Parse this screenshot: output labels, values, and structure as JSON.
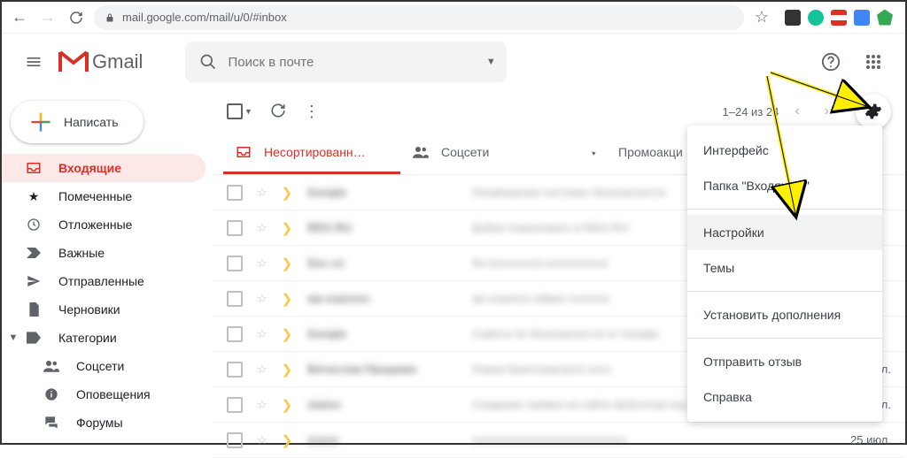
{
  "browser": {
    "url": "mail.google.com/mail/u/0/#inbox"
  },
  "header": {
    "logo_text": "Gmail",
    "search_placeholder": "Поиск в почте"
  },
  "sidebar": {
    "compose": "Написать",
    "items": [
      {
        "label": "Входящие"
      },
      {
        "label": "Помеченные"
      },
      {
        "label": "Отложенные"
      },
      {
        "label": "Важные"
      },
      {
        "label": "Отправленные"
      },
      {
        "label": "Черновики"
      },
      {
        "label": "Категории"
      }
    ],
    "sub_items": [
      {
        "label": "Соцсети"
      },
      {
        "label": "Оповещения"
      },
      {
        "label": "Форумы"
      }
    ]
  },
  "toolbar": {
    "pager_text": "1–24 из 24"
  },
  "tabs": [
    {
      "label": "Несортированн…"
    },
    {
      "label": "Соцсети"
    },
    {
      "label": "Промоакци"
    }
  ],
  "mails": [
    {
      "sender": "Google",
      "subject": "Оповещение системы безопасности",
      "date": ""
    },
    {
      "sender": "REG RU",
      "subject": "Добро пожаловать в REG.RU",
      "date": ""
    },
    {
      "sender": "Doc xx",
      "subject": "Re [xxxxxxxx] xxxxxxxxxxx",
      "date": ""
    },
    {
      "sender": "wp express",
      "subject": "wp express обмен xxxxxxx",
      "date": ""
    },
    {
      "sender": "Google",
      "subject": "Советы по безопасности от Google",
      "date": ""
    },
    {
      "sender": "Вячеслав Продажи",
      "subject": "Новая Криптовалюта xxxx",
      "date": "29 июл."
    },
    {
      "sender": "status",
      "subject": "Создание заявки на сайте bjclicomat org",
      "date": "27 июл."
    },
    {
      "sender": "xxxxx",
      "subject": "xxxxxxxxxxxxxxxxxxxxxxxxxxx",
      "date": "25 июл."
    }
  ],
  "menu": {
    "items": [
      "Интерфейс",
      "Папка \"Входящие\"",
      "Настройки",
      "Темы",
      "Установить дополнения",
      "Отправить отзыв",
      "Справка"
    ]
  }
}
